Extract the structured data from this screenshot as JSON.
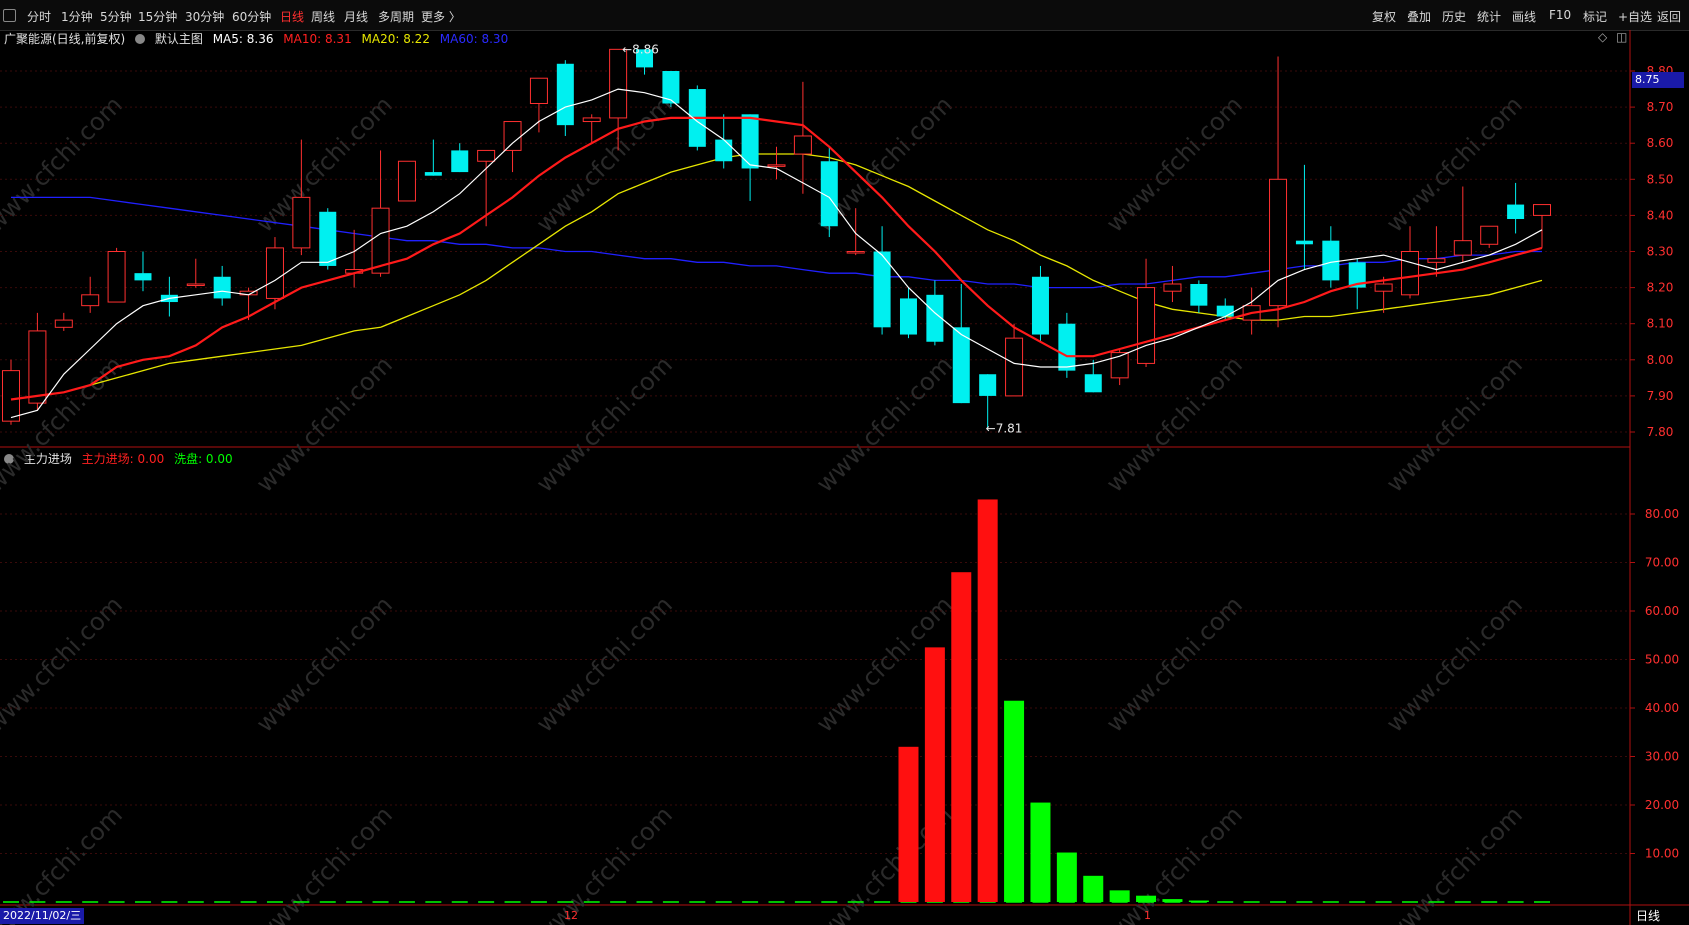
{
  "toolbar": {
    "left": [
      "分时",
      "1分钟",
      "5分钟",
      "15分钟",
      "30分钟",
      "60分钟",
      "日线",
      "周线",
      "月线",
      "多周期",
      "更多 〉"
    ],
    "active": "日线",
    "right": [
      "复权",
      "叠加",
      "历史",
      "统计",
      "画线",
      "F10",
      "标记",
      "+自选",
      "返回"
    ]
  },
  "main_legend": {
    "stock": "广聚能源(日线,前复权)",
    "chart_name": "默认主图",
    "ma5": "MA5: 8.36",
    "ma10": "MA10: 8.31",
    "ma20": "MA20: 8.22",
    "ma60": "MA60: 8.30"
  },
  "sub_legend": {
    "name": "主力进场",
    "zljc": "主力进场: 0.00",
    "xp": "洗盘: 0.00"
  },
  "price_tag": "8.75",
  "high_label": "8.86",
  "low_label": "7.81",
  "bottom": {
    "date": "2022/11/02/三",
    "tick_12": "12",
    "tick_1": "1",
    "period": "日线"
  },
  "watermark": "www.cfchi.com",
  "colors": {
    "up": "#ff3030",
    "down": "#00f0f0",
    "ma5": "#ffffff",
    "ma10": "#ff1a1a",
    "ma20": "#e6e600",
    "ma60": "#2020ff",
    "green_bar": "#00ff00"
  },
  "chart_data": [
    {
      "type": "candlestick",
      "title": "广聚能源(日线,前复权)",
      "y_ticks": [
        8.8,
        8.7,
        8.6,
        8.5,
        8.4,
        8.3,
        8.2,
        8.1,
        8.0,
        7.9,
        7.8
      ],
      "ylim": [
        7.77,
        8.87
      ],
      "candles": [
        {
          "o": 7.83,
          "h": 8.0,
          "l": 7.82,
          "c": 7.97
        },
        {
          "o": 7.88,
          "h": 8.13,
          "l": 7.86,
          "c": 8.08
        },
        {
          "o": 8.09,
          "h": 8.13,
          "l": 8.08,
          "c": 8.11
        },
        {
          "o": 8.15,
          "h": 8.23,
          "l": 8.13,
          "c": 8.18
        },
        {
          "o": 8.16,
          "h": 8.31,
          "l": 8.16,
          "c": 8.3
        },
        {
          "o": 8.24,
          "h": 8.3,
          "l": 8.19,
          "c": 8.22
        },
        {
          "o": 8.18,
          "h": 8.23,
          "l": 8.12,
          "c": 8.16
        },
        {
          "o": 8.21,
          "h": 8.28,
          "l": 8.2,
          "c": 8.21
        },
        {
          "o": 8.23,
          "h": 8.26,
          "l": 8.15,
          "c": 8.17
        },
        {
          "o": 8.18,
          "h": 8.2,
          "l": 8.11,
          "c": 8.19
        },
        {
          "o": 8.17,
          "h": 8.34,
          "l": 8.14,
          "c": 8.31
        },
        {
          "o": 8.31,
          "h": 8.61,
          "l": 8.29,
          "c": 8.45
        },
        {
          "o": 8.41,
          "h": 8.42,
          "l": 8.25,
          "c": 8.26
        },
        {
          "o": 8.24,
          "h": 8.36,
          "l": 8.2,
          "c": 8.25
        },
        {
          "o": 8.24,
          "h": 8.58,
          "l": 8.23,
          "c": 8.42
        },
        {
          "o": 8.44,
          "h": 8.55,
          "l": 8.44,
          "c": 8.55
        },
        {
          "o": 8.52,
          "h": 8.61,
          "l": 8.51,
          "c": 8.51
        },
        {
          "o": 8.58,
          "h": 8.6,
          "l": 8.52,
          "c": 8.52
        },
        {
          "o": 8.55,
          "h": 8.58,
          "l": 8.37,
          "c": 8.58
        },
        {
          "o": 8.58,
          "h": 8.66,
          "l": 8.52,
          "c": 8.66
        },
        {
          "o": 8.71,
          "h": 8.75,
          "l": 8.63,
          "c": 8.78
        },
        {
          "o": 8.82,
          "h": 8.83,
          "l": 8.62,
          "c": 8.65
        },
        {
          "o": 8.66,
          "h": 8.68,
          "l": 8.6,
          "c": 8.67
        },
        {
          "o": 8.67,
          "h": 8.86,
          "l": 8.58,
          "c": 8.86
        },
        {
          "o": 8.86,
          "h": 8.86,
          "l": 8.79,
          "c": 8.81
        },
        {
          "o": 8.8,
          "h": 8.8,
          "l": 8.7,
          "c": 8.71
        },
        {
          "o": 8.75,
          "h": 8.76,
          "l": 8.58,
          "c": 8.59
        },
        {
          "o": 8.61,
          "h": 8.68,
          "l": 8.53,
          "c": 8.55
        },
        {
          "o": 8.68,
          "h": 8.68,
          "l": 8.44,
          "c": 8.53
        },
        {
          "o": 8.54,
          "h": 8.59,
          "l": 8.5,
          "c": 8.54
        },
        {
          "o": 8.57,
          "h": 8.77,
          "l": 8.46,
          "c": 8.62
        },
        {
          "o": 8.55,
          "h": 8.59,
          "l": 8.34,
          "c": 8.37
        },
        {
          "o": 8.3,
          "h": 8.42,
          "l": 8.29,
          "c": 8.3
        },
        {
          "o": 8.3,
          "h": 8.37,
          "l": 8.07,
          "c": 8.09
        },
        {
          "o": 8.17,
          "h": 8.2,
          "l": 8.06,
          "c": 8.07
        },
        {
          "o": 8.18,
          "h": 8.22,
          "l": 8.04,
          "c": 8.05
        },
        {
          "o": 8.09,
          "h": 8.21,
          "l": 7.88,
          "c": 7.88
        },
        {
          "o": 7.96,
          "h": 7.96,
          "l": 7.81,
          "c": 7.9
        },
        {
          "o": 7.9,
          "h": 8.1,
          "l": 7.9,
          "c": 8.06
        },
        {
          "o": 8.23,
          "h": 8.26,
          "l": 8.05,
          "c": 8.07
        },
        {
          "o": 8.1,
          "h": 8.13,
          "l": 7.95,
          "c": 7.97
        },
        {
          "o": 7.96,
          "h": 8.0,
          "l": 7.91,
          "c": 7.91
        },
        {
          "o": 7.95,
          "h": 8.03,
          "l": 7.93,
          "c": 8.02
        },
        {
          "o": 7.99,
          "h": 8.28,
          "l": 7.98,
          "c": 8.2
        },
        {
          "o": 8.19,
          "h": 8.26,
          "l": 8.16,
          "c": 8.21
        },
        {
          "o": 8.21,
          "h": 8.22,
          "l": 8.13,
          "c": 8.15
        },
        {
          "o": 8.15,
          "h": 8.17,
          "l": 8.11,
          "c": 8.12
        },
        {
          "o": 8.11,
          "h": 8.2,
          "l": 8.07,
          "c": 8.15
        },
        {
          "o": 8.15,
          "h": 8.84,
          "l": 8.09,
          "c": 8.5
        },
        {
          "o": 8.33,
          "h": 8.54,
          "l": 8.25,
          "c": 8.32
        },
        {
          "o": 8.33,
          "h": 8.37,
          "l": 8.2,
          "c": 8.22
        },
        {
          "o": 8.27,
          "h": 8.28,
          "l": 8.14,
          "c": 8.2
        },
        {
          "o": 8.19,
          "h": 8.23,
          "l": 8.13,
          "c": 8.21
        },
        {
          "o": 8.18,
          "h": 8.37,
          "l": 8.17,
          "c": 8.3
        },
        {
          "o": 8.27,
          "h": 8.37,
          "l": 8.23,
          "c": 8.28
        },
        {
          "o": 8.29,
          "h": 8.48,
          "l": 8.27,
          "c": 8.33
        },
        {
          "o": 8.32,
          "h": 8.37,
          "l": 8.31,
          "c": 8.37
        },
        {
          "o": 8.43,
          "h": 8.49,
          "l": 8.35,
          "c": 8.39
        },
        {
          "o": 8.4,
          "h": 8.43,
          "l": 8.31,
          "c": 8.43
        }
      ],
      "ma5": [
        7.84,
        7.86,
        7.96,
        8.03,
        8.1,
        8.15,
        8.17,
        8.18,
        8.19,
        8.18,
        8.22,
        8.27,
        8.27,
        8.3,
        8.35,
        8.37,
        8.41,
        8.46,
        8.53,
        8.6,
        8.66,
        8.7,
        8.72,
        8.75,
        8.74,
        8.72,
        8.66,
        8.61,
        8.54,
        8.53,
        8.49,
        8.45,
        8.35,
        8.29,
        8.2,
        8.13,
        8.07,
        8.03,
        7.99,
        7.98,
        7.98,
        7.99,
        8.01,
        8.04,
        8.06,
        8.09,
        8.12,
        8.16,
        8.22,
        8.25,
        8.27,
        8.28,
        8.29,
        8.27,
        8.25,
        8.27,
        8.29,
        8.32,
        8.36
      ],
      "ma10": [
        7.89,
        7.9,
        7.91,
        7.93,
        7.98,
        8.0,
        8.01,
        8.04,
        8.09,
        8.12,
        8.16,
        8.2,
        8.22,
        8.24,
        8.26,
        8.28,
        8.32,
        8.35,
        8.4,
        8.45,
        8.51,
        8.56,
        8.6,
        8.64,
        8.66,
        8.67,
        8.67,
        8.67,
        8.67,
        8.66,
        8.65,
        8.59,
        8.52,
        8.45,
        8.37,
        8.3,
        8.22,
        8.15,
        8.09,
        8.05,
        8.01,
        8.01,
        8.03,
        8.05,
        8.07,
        8.09,
        8.11,
        8.13,
        8.14,
        8.16,
        8.19,
        8.21,
        8.22,
        8.23,
        8.24,
        8.25,
        8.27,
        8.29,
        8.31
      ],
      "ma20": [
        7.91,
        7.93,
        7.95,
        7.97,
        7.99,
        8.0,
        8.01,
        8.02,
        8.03,
        8.04,
        8.06,
        8.08,
        8.09,
        8.12,
        8.15,
        8.18,
        8.22,
        8.27,
        8.32,
        8.37,
        8.41,
        8.46,
        8.49,
        8.52,
        8.54,
        8.56,
        8.57,
        8.57,
        8.57,
        8.56,
        8.54,
        8.51,
        8.48,
        8.44,
        8.4,
        8.36,
        8.33,
        8.29,
        8.26,
        8.22,
        8.19,
        8.16,
        8.14,
        8.13,
        8.12,
        8.11,
        8.11,
        8.12,
        8.12,
        8.13,
        8.14,
        8.15,
        8.16,
        8.17,
        8.18,
        8.2,
        8.22
      ],
      "ma60": [
        8.45,
        8.45,
        8.45,
        8.45,
        8.44,
        8.43,
        8.42,
        8.41,
        8.4,
        8.39,
        8.38,
        8.37,
        8.36,
        8.35,
        8.34,
        8.33,
        8.33,
        8.32,
        8.32,
        8.31,
        8.31,
        8.3,
        8.3,
        8.29,
        8.28,
        8.28,
        8.27,
        8.27,
        8.26,
        8.26,
        8.25,
        8.24,
        8.24,
        8.23,
        8.23,
        8.22,
        8.22,
        8.21,
        8.21,
        8.2,
        8.2,
        8.2,
        8.21,
        8.21,
        8.22,
        8.23,
        8.23,
        8.24,
        8.25,
        8.26,
        8.26,
        8.27,
        8.27,
        8.28,
        8.28,
        8.29,
        8.29,
        8.3,
        8.3
      ]
    },
    {
      "type": "bar",
      "title": "主力进场",
      "y_ticks": [
        80.0,
        70.0,
        60.0,
        50.0,
        40.0,
        30.0,
        20.0,
        10.0
      ],
      "ylim": [
        0,
        86
      ],
      "series": [
        {
          "name": "主力进场",
          "color": "#ff1010",
          "index_start": 34,
          "values": [
            32,
            52.5,
            68,
            83
          ]
        },
        {
          "name": "洗盘",
          "color": "#00ff00",
          "index_start": 38,
          "values": [
            41.5,
            20.5,
            10.2,
            5.4,
            2.4,
            1.3,
            0.6,
            0.3
          ]
        }
      ],
      "baseline_dashes": 59
    }
  ]
}
